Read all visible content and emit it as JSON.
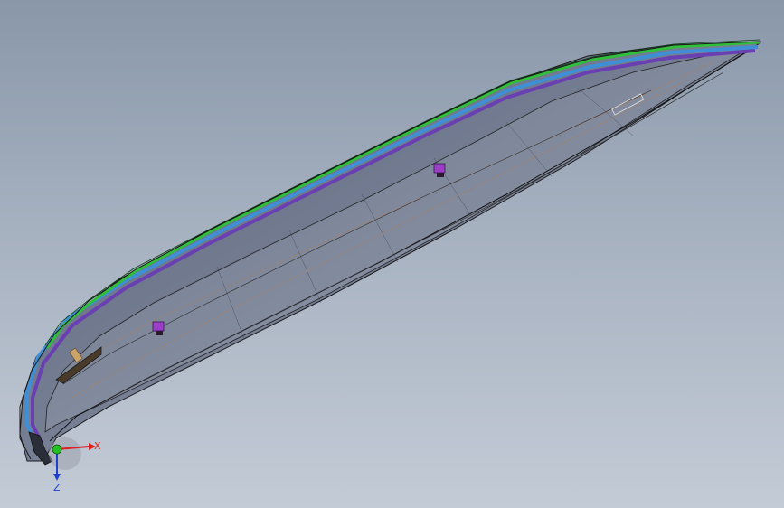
{
  "viewport": {
    "background_top": "#8997a9",
    "background_bottom": "#c3cbd6"
  },
  "model": {
    "body_color": "#6f7a90",
    "edge_green": "#2fbf3a",
    "edge_blue": "#3f8fd6",
    "edge_purple": "#6a3fb2",
    "edge_line": "#1a1a1a",
    "feature_color": "#9b3fc7",
    "sketch_line": "#b47a4a"
  },
  "triad": {
    "x_label": "X",
    "z_label": "Z",
    "x_color": "#e02020",
    "y_color": "#20c020",
    "z_color": "#2040d0"
  }
}
